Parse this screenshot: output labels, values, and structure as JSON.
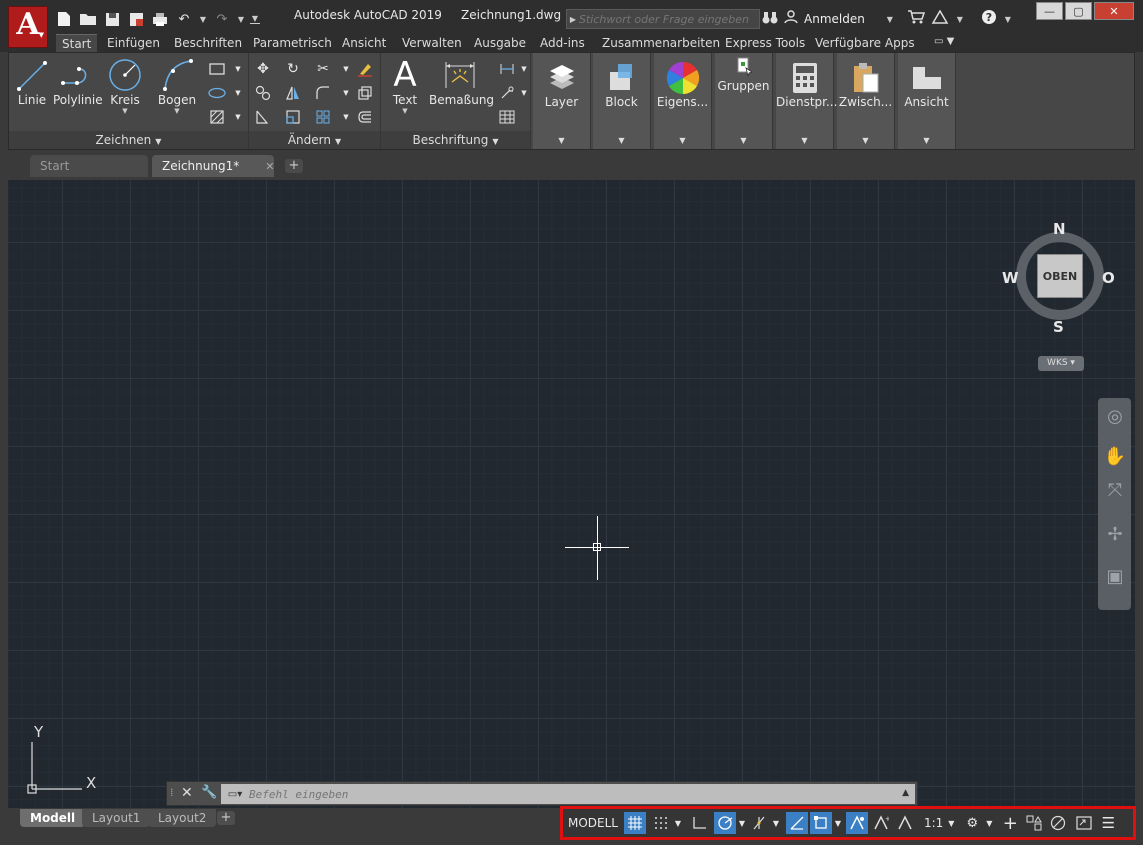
{
  "title": {
    "app_name": "Autodesk AutoCAD 2019",
    "file_name": "Zeichnung1.dwg",
    "search_placeholder": "Stichwort oder Frage eingeben",
    "signin_label": "Anmelden"
  },
  "ribbon_tabs": [
    "Start",
    "Einfügen",
    "Beschriften",
    "Parametrisch",
    "Ansicht",
    "Verwalten",
    "Ausgabe",
    "Add-ins",
    "Zusammenarbeiten",
    "Express Tools",
    "Verfügbare Apps"
  ],
  "ribbon": {
    "draw_group": {
      "title": "Zeichnen",
      "buttons": [
        "Linie",
        "Polylinie",
        "Kreis",
        "Bogen"
      ]
    },
    "modify_group": {
      "title": "Ändern"
    },
    "annotation_group": {
      "title": "Beschriftung",
      "buttons": [
        "Text",
        "Bemaßung"
      ]
    },
    "panels": [
      "Layer",
      "Block",
      "Eigens...",
      "Gruppen",
      "Dienstpr...",
      "Zwisch...",
      "Ansicht"
    ]
  },
  "file_tabs": {
    "start": "Start",
    "drawing": "Zeichnung1*"
  },
  "viewcube": {
    "north": "N",
    "south": "S",
    "west": "W",
    "east": "O",
    "face": "OBEN",
    "ucs_label": "WKS"
  },
  "ucs_icon": {
    "x_label": "X",
    "y_label": "Y"
  },
  "command_line": {
    "placeholder": "Befehl eingeben"
  },
  "layout_tabs": [
    "Modell",
    "Layout1",
    "Layout2"
  ],
  "status_bar": {
    "model_label": "MODELL",
    "scale_label": "1:1"
  },
  "colors": {
    "app_button": "#b01b1b",
    "canvas_bg": "#212830",
    "status_active": "#3b7fc4",
    "status_highlight_border": "#e01010"
  }
}
